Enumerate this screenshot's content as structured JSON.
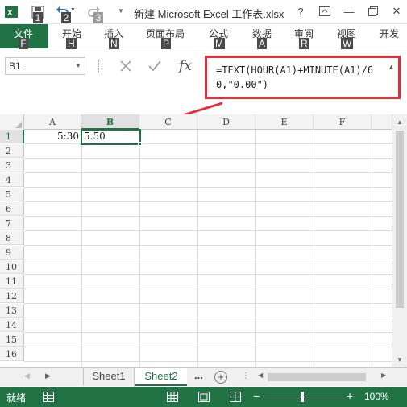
{
  "titlebar": {
    "title": "新建 Microsoft Excel 工作表.xlsx - Excel",
    "keytips": [
      "1",
      "2",
      "3"
    ],
    "help_label": "?",
    "minimize_label": "—",
    "close_label": "✕"
  },
  "ribbon": {
    "tabs": [
      {
        "label": "文件",
        "keytip": "F"
      },
      {
        "label": "开始",
        "keytip": "H"
      },
      {
        "label": "插入",
        "keytip": "N"
      },
      {
        "label": "页面布局",
        "keytip": "P"
      },
      {
        "label": "公式",
        "keytip": "M"
      },
      {
        "label": "数据",
        "keytip": "A"
      },
      {
        "label": "审阅",
        "keytip": "R"
      },
      {
        "label": "视图",
        "keytip": "W"
      },
      {
        "label": "开发",
        "keytip": ""
      }
    ]
  },
  "formula_bar": {
    "name_box": "B1",
    "fx_label": "fx",
    "formula": "=TEXT(HOUR(A1)+MINUTE(A1)/60,\"0.00\")"
  },
  "grid": {
    "columns": [
      "A",
      "B",
      "C",
      "D",
      "E",
      "F"
    ],
    "rows": [
      "1",
      "2",
      "3",
      "4",
      "5",
      "6",
      "7",
      "8",
      "9",
      "10",
      "11",
      "12",
      "13",
      "14",
      "15",
      "16"
    ],
    "cells": {
      "A1": "5:30",
      "B1": "5.50"
    },
    "active_cell": "B1"
  },
  "sheets": {
    "tabs": [
      "Sheet1",
      "Sheet2"
    ],
    "active": "Sheet2",
    "more_label": "...",
    "add_label": "+"
  },
  "status_bar": {
    "status": "就绪",
    "zoom_minus": "−",
    "zoom_plus": "+",
    "zoom": "100%",
    "zoom_value": 100
  },
  "colors": {
    "accent": "#217346",
    "annotation": "#e0303c"
  }
}
